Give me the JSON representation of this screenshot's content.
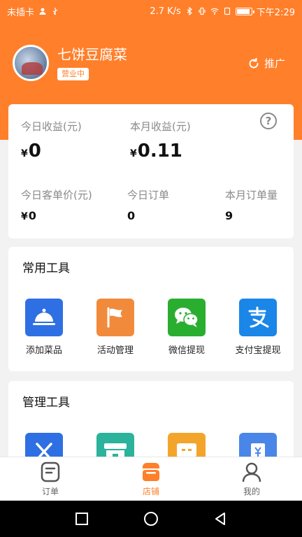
{
  "status_bar": {
    "carrier": "未插卡",
    "speed": "2.7 K/s",
    "time": "下午2:29",
    "battery_level": 0.85
  },
  "profile": {
    "shop_name": "七饼豆腐菜",
    "status": "营业中",
    "promote_label": "推广"
  },
  "earnings": {
    "currency": "¥",
    "today_label": "今日收益(元)",
    "today_value": "0",
    "month_label": "本月收益(元)",
    "month_value": "0.11",
    "avg_label": "今日客单价(元)",
    "avg_value": "0",
    "orders_today_label": "今日订单",
    "orders_today_value": "0",
    "orders_month_label": "本月订单量",
    "orders_month_value": "9",
    "help_icon": "?"
  },
  "common_tools": {
    "title": "常用工具",
    "items": [
      {
        "label": "添加菜品",
        "icon": "food-cover-icon",
        "color": "#2f6fe4"
      },
      {
        "label": "活动管理",
        "icon": "flag-icon",
        "color": "#f28a3c"
      },
      {
        "label": "微信提现",
        "icon": "wechat-icon",
        "color": "#2aae2f"
      },
      {
        "label": "支付宝提现",
        "icon": "alipay-icon",
        "color": "#1a86e8"
      }
    ]
  },
  "manage_tools": {
    "title": "管理工具",
    "items": [
      {
        "icon": "utensils-icon",
        "color": "#2f6fe4"
      },
      {
        "icon": "storefront-icon",
        "color": "#2bb39b"
      },
      {
        "icon": "chat-icon",
        "color": "#f3a52b"
      },
      {
        "icon": "wallet-icon",
        "color": "#4a86e8"
      }
    ]
  },
  "bottom_nav": {
    "items": [
      {
        "label": "订单",
        "icon": "orders-icon"
      },
      {
        "label": "店铺",
        "icon": "shop-icon"
      },
      {
        "label": "我的",
        "icon": "profile-icon"
      }
    ],
    "active_color": "#ff7f2a"
  },
  "colors": {
    "brand": "#ff7f2a",
    "background": "#f2f2f2"
  }
}
